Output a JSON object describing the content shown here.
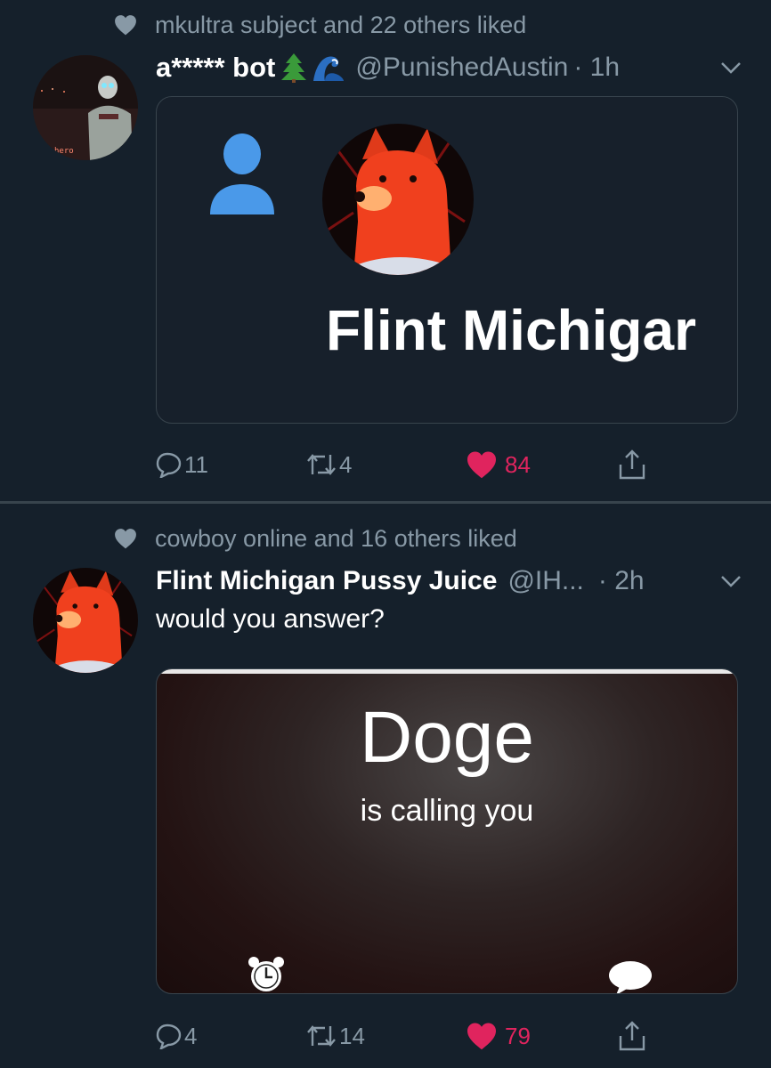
{
  "tweets": [
    {
      "social_context": "mkultra subject and 22 others liked",
      "author_name": "a***** bot",
      "author_emojis": [
        "tree-emoji",
        "wave-emoji"
      ],
      "handle": "@PunishedAustin",
      "time": "· 1h",
      "avatar_caption": "hero",
      "card": {
        "overlay_text": "Flint Michigar"
      },
      "actions": {
        "replies": "11",
        "retweets": "4",
        "likes": "84"
      }
    },
    {
      "social_context": "cowboy online and 16 others liked",
      "author_name": "Flint Michigan Pussy Juice",
      "handle": "@IH...",
      "time": "· 2h",
      "text": "would you answer?",
      "card": {
        "title": "Doge",
        "subtitle": "is calling you"
      },
      "actions": {
        "replies": "4",
        "retweets": "14",
        "likes": "79"
      }
    }
  ],
  "colors": {
    "background": "#15202b",
    "secondary_text": "#8899a6",
    "like": "#e0245e",
    "divider": "#38444d",
    "profile_blue": "#4a99e9"
  }
}
